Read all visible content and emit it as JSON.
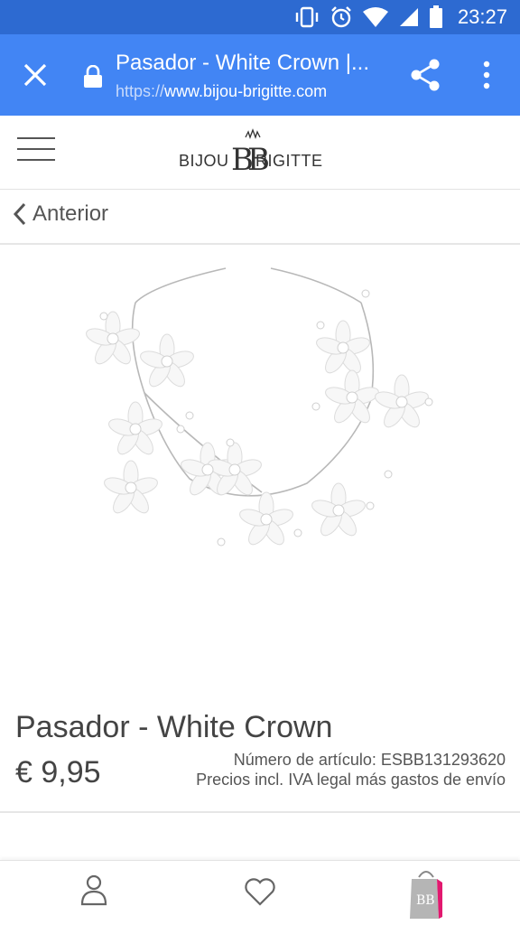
{
  "status_bar": {
    "time": "23:27",
    "icons": [
      "vibrate-icon",
      "alarm-icon",
      "wifi-icon",
      "signal-icon",
      "battery-icon"
    ]
  },
  "toolbar": {
    "title": "Pasador - White Crown |...",
    "url_scheme": "https://",
    "url_host": "www.bijou-brigitte.com",
    "icons": [
      "close-icon",
      "lock-icon",
      "share-icon",
      "more-vert-icon"
    ]
  },
  "header": {
    "logo_left": "BIJOU",
    "logo_right": "RIGITTE",
    "icons": [
      "hamburger-menu-icon",
      "bb-logo-icon"
    ]
  },
  "back": {
    "label": "Anterior"
  },
  "product": {
    "name": "Pasador - White Crown",
    "price": "€ 9,95",
    "article_number": "Número de artículo: ESBB131293620",
    "tax_note": "Precios incl. IVA legal más gastos de envío"
  },
  "bottom_nav": {
    "icons": [
      "account-icon",
      "heart-icon",
      "shopping-bag-icon"
    ]
  },
  "colors": {
    "status_bar": "#2d6ad1",
    "toolbar": "#4285f4",
    "cart_accent": "#e2186f"
  }
}
